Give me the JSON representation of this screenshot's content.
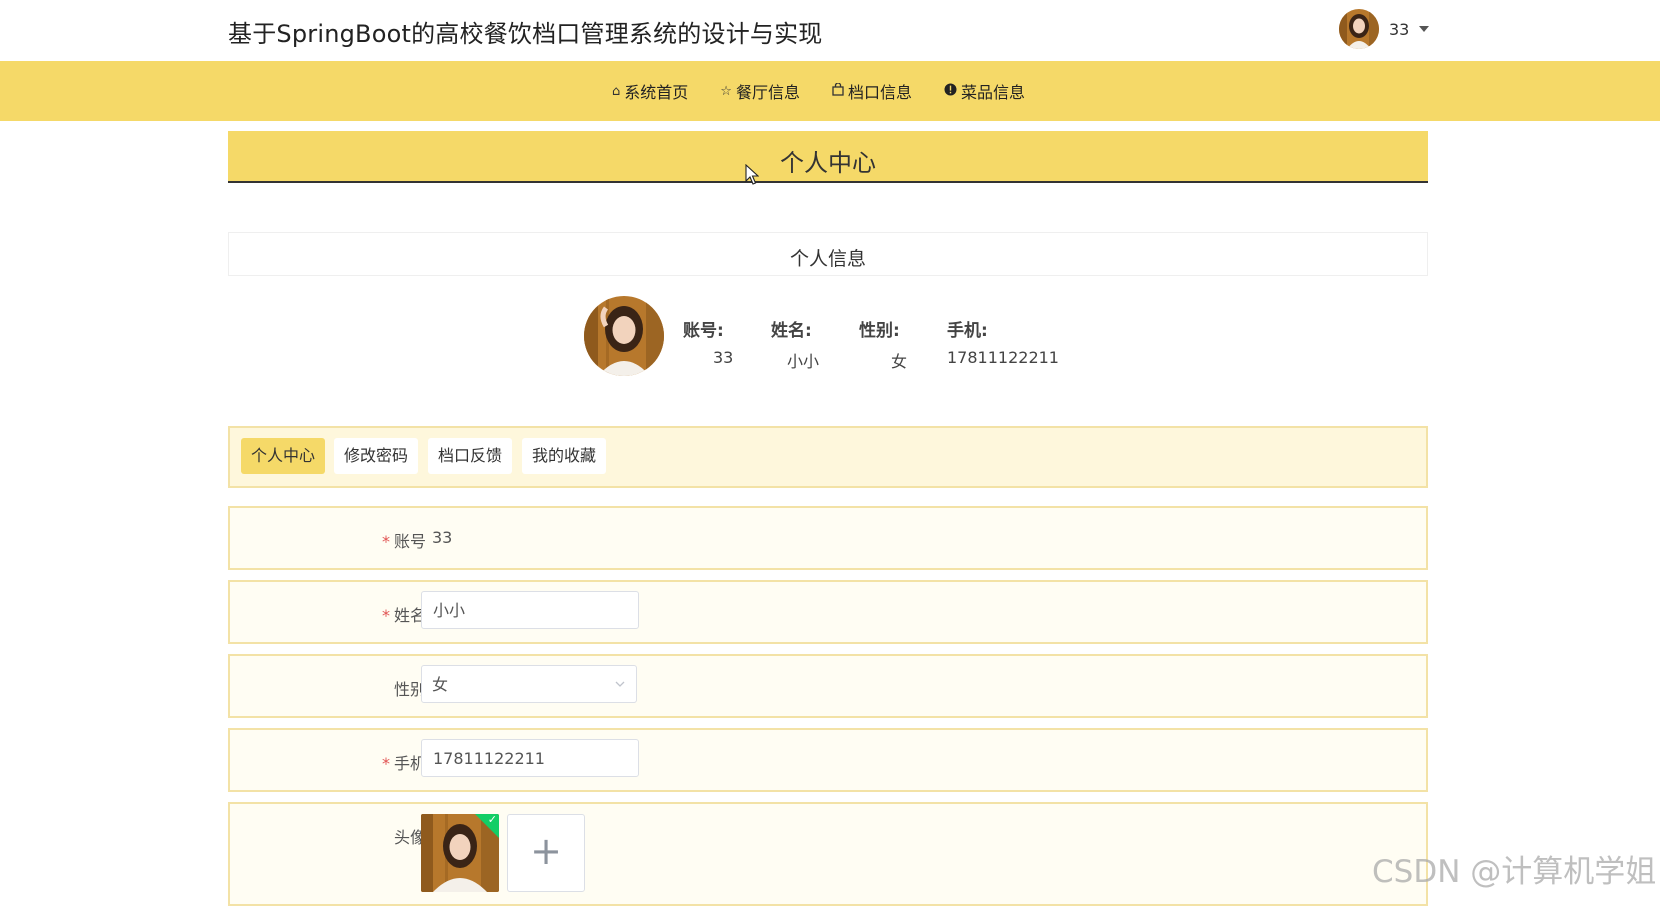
{
  "header": {
    "title": "基于SpringBoot的高校餐饮档口管理系统的设计与实现",
    "user_name": "33"
  },
  "nav": {
    "items": [
      {
        "icon": "home-icon",
        "label": "系统首页"
      },
      {
        "icon": "star-icon",
        "label": "餐厅信息"
      },
      {
        "icon": "bag-icon",
        "label": "档口信息"
      },
      {
        "icon": "info-icon",
        "label": "菜品信息"
      }
    ]
  },
  "page": {
    "title": "个人中心",
    "info_title": "个人信息"
  },
  "profile": {
    "labels": {
      "account": "账号:",
      "name": "姓名:",
      "gender": "性别:",
      "phone": "手机:"
    },
    "values": {
      "account": "33",
      "name": "小小",
      "gender": "女",
      "phone": "17811122211"
    }
  },
  "tabs": [
    {
      "label": "个人中心",
      "active": true
    },
    {
      "label": "修改密码",
      "active": false
    },
    {
      "label": "档口反馈",
      "active": false
    },
    {
      "label": "我的收藏",
      "active": false
    }
  ],
  "form": {
    "required_mark": "*",
    "account": {
      "label": "账号",
      "value": "33"
    },
    "name": {
      "label": "姓名",
      "value": "小小"
    },
    "gender": {
      "label": "性别",
      "value": "女"
    },
    "phone": {
      "label": "手机",
      "value": "17811122211"
    },
    "avatar": {
      "label": "头像",
      "add_symbol": "+"
    }
  },
  "watermark": "CSDN @计算机学姐",
  "colors": {
    "accent": "#f5d968",
    "panel": "#fef7dc",
    "border": "#f3e2a6",
    "required": "#e15353",
    "success": "#13ce66"
  }
}
